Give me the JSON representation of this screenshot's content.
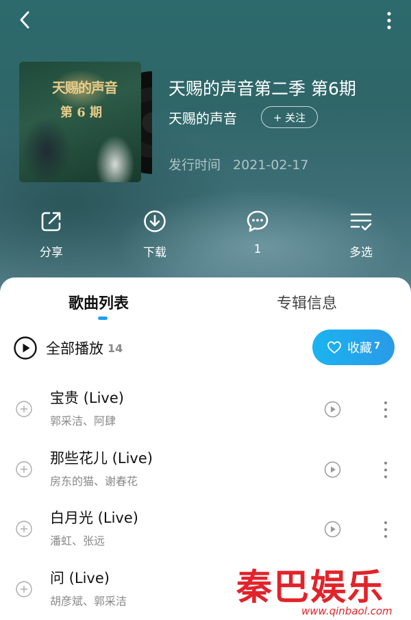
{
  "header": {
    "album_title": "天赐的声音第二季 第6期",
    "artist": "天赐的声音",
    "follow_label": "+ 关注",
    "release_label": "发行时间",
    "release_date": "2021-02-17",
    "cover_title": "天赐的声音",
    "cover_episode": "第 6 期"
  },
  "actions": [
    {
      "label": "分享",
      "icon": "share-icon"
    },
    {
      "label": "下载",
      "icon": "download-icon"
    },
    {
      "label": "1",
      "icon": "comment-icon"
    },
    {
      "label": "多选",
      "icon": "multiselect-icon"
    }
  ],
  "tabs": [
    {
      "label": "歌曲列表",
      "active": true
    },
    {
      "label": "专辑信息",
      "active": false
    }
  ],
  "playall": {
    "label": "全部播放",
    "count": "14"
  },
  "collect": {
    "label": "收藏",
    "count": "7"
  },
  "songs": [
    {
      "title": "宝贵 (Live)",
      "artists": "郭采洁、阿肆"
    },
    {
      "title": "那些花儿 (Live)",
      "artists": "房东的猫、谢春花"
    },
    {
      "title": "白月光 (Live)",
      "artists": "潘虹、张远"
    },
    {
      "title": "问 (Live)",
      "artists": "胡彦斌、郭采洁"
    }
  ],
  "watermark": {
    "text": "秦巴娱乐",
    "url": "www.qinbaol.com"
  },
  "colors": {
    "accent": "#1ea1f1",
    "watermark": "#e2232a"
  }
}
